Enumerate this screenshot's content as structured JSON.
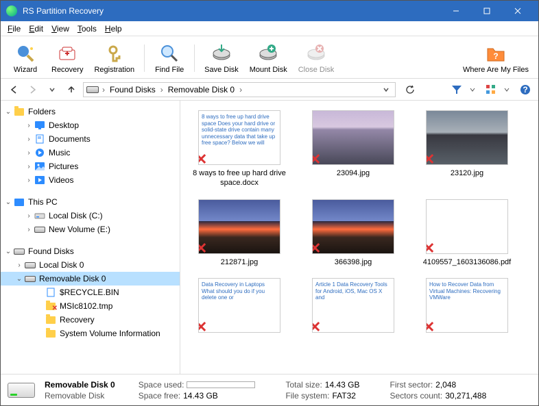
{
  "app": {
    "title": "RS Partition Recovery"
  },
  "menu": [
    "File",
    "Edit",
    "View",
    "Tools",
    "Help"
  ],
  "toolbar": {
    "wizard": "Wizard",
    "recovery": "Recovery",
    "registration": "Registration",
    "find_file": "Find File",
    "save_disk": "Save Disk",
    "mount_disk": "Mount Disk",
    "close_disk": "Close Disk",
    "where_files": "Where Are My Files"
  },
  "breadcrumb": {
    "seg1": "Found Disks",
    "seg2": "Removable Disk 0"
  },
  "tree": {
    "folders": "Folders",
    "desktop": "Desktop",
    "documents": "Documents",
    "music": "Music",
    "pictures": "Pictures",
    "videos": "Videos",
    "this_pc": "This PC",
    "local_c": "Local Disk (C:)",
    "new_vol_e": "New Volume (E:)",
    "found_disks": "Found Disks",
    "local_disk_0": "Local Disk 0",
    "removable_0": "Removable Disk 0",
    "recycle": "$RECYCLE.BIN",
    "msic": "MSIc8102.tmp",
    "recovery": "Recovery",
    "sysvol": "System Volume Information"
  },
  "files": [
    {
      "name": "8 ways to free up hard drive space.docx",
      "preview": "8 ways to free up hard drive space\nDoes your hard drive or solid-state drive contain many unnecessary data that take up free space? Below we will",
      "type": "doc"
    },
    {
      "name": "23094.jpg",
      "type": "sea"
    },
    {
      "name": "23120.jpg",
      "type": "rocks"
    },
    {
      "name": "212871.jpg",
      "type": "mountain"
    },
    {
      "name": "366398.jpg",
      "type": "mountain"
    },
    {
      "name": "4109557_1603136086.pdf",
      "type": "pdf"
    },
    {
      "name": "",
      "preview": "Data Recovery in Laptops\nWhat should you do if you delete one or",
      "type": "doc"
    },
    {
      "name": "",
      "preview": "Article 1\nData Recovery Tools for Android, iOS, Mac OS X and",
      "type": "doc"
    },
    {
      "name": "",
      "preview": "How to Recover Data from Virtual Machines: Recovering VMWare",
      "type": "doc"
    }
  ],
  "status": {
    "disk_name": "Removable Disk 0",
    "disk_type": "Removable Disk",
    "space_used_k": "Space used:",
    "space_free_k": "Space free:",
    "space_free_v": "14.43 GB",
    "total_size_k": "Total size:",
    "total_size_v": "14.43 GB",
    "fs_k": "File system:",
    "fs_v": "FAT32",
    "first_sector_k": "First sector:",
    "first_sector_v": "2,048",
    "sectors_k": "Sectors count:",
    "sectors_v": "30,271,488"
  }
}
